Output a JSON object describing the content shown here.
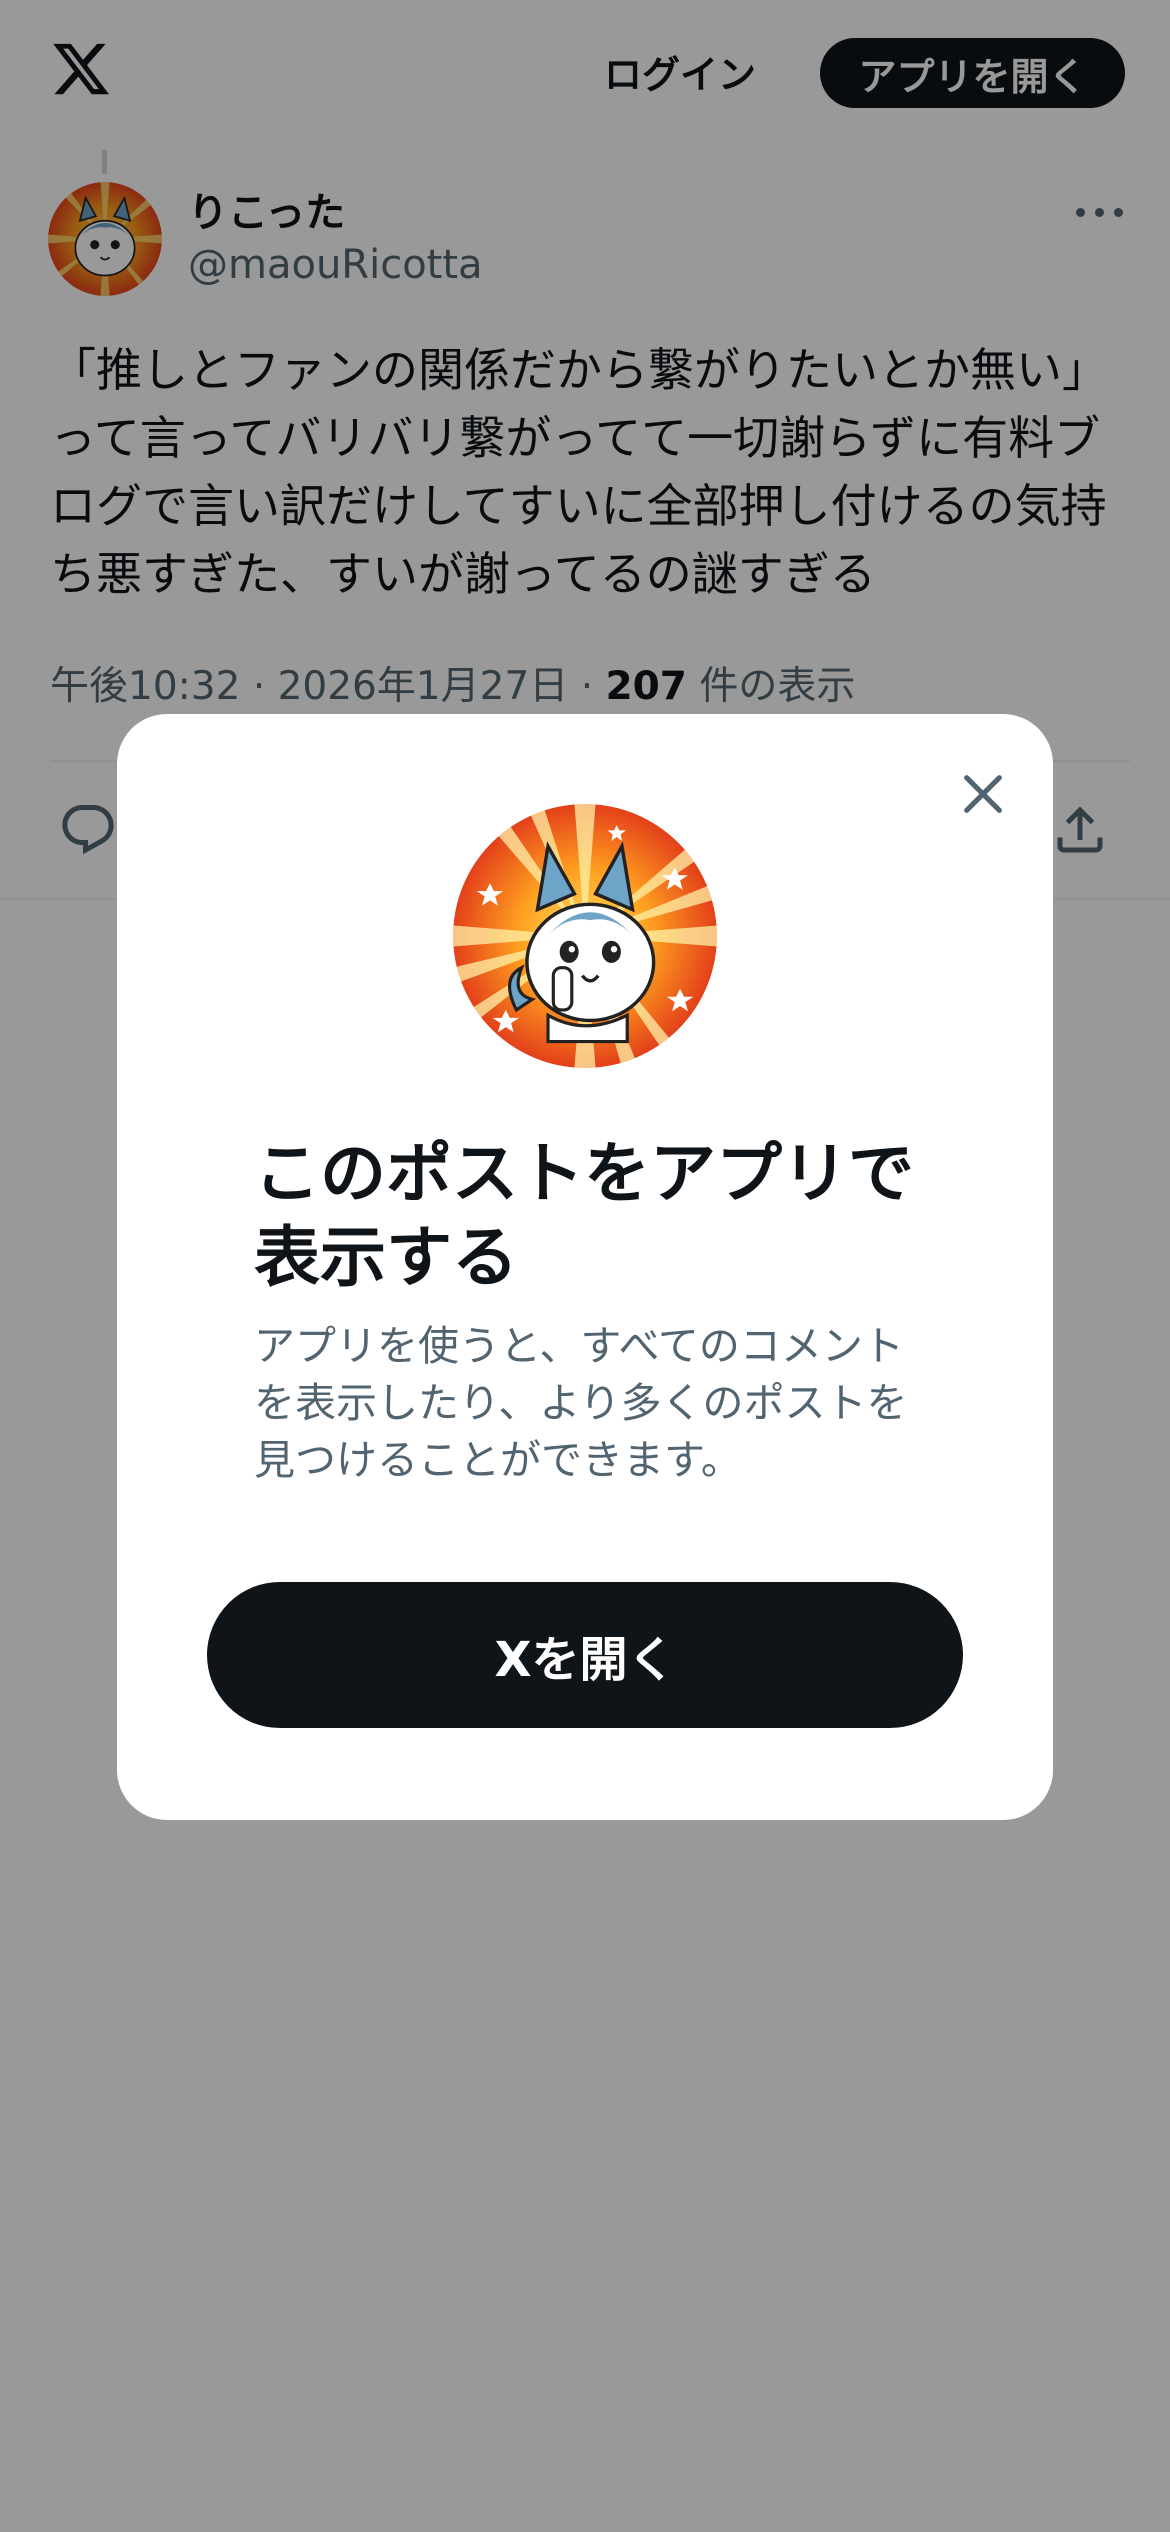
{
  "header": {
    "logo": "x-logo",
    "login_label": "ログイン",
    "open_app_label": "アプリを開く"
  },
  "post": {
    "display_name": "りこった",
    "handle": "@maouRicotta",
    "text": "「推しとファンの関係だから繋がりたいとか無い」って言ってバリバリ繋がってて一切謝らずに有料ブログで言い訳だけしてすいに全部押し付けるの気持ち悪すぎた、すいが謝ってるの謎すぎる",
    "time": "午後10:32",
    "date": "2026年1月27日",
    "views_count": "207",
    "views_label": "件の表示",
    "separator": "·"
  },
  "actions": {
    "reply_icon": "reply-icon",
    "share_icon": "share-icon"
  },
  "modal": {
    "close_icon": "close-icon",
    "title": "このポストをアプリで表示する",
    "description": "アプリを使うと、すべてのコメントを表示したり、より多くのポストを見つけることができます。",
    "open_button_label": "Xを開く"
  },
  "colors": {
    "primary_text": "#0f1419",
    "secondary_text": "#536471",
    "button_bg": "#0f1419",
    "overlay": "rgba(0,0,0,0.4)"
  }
}
